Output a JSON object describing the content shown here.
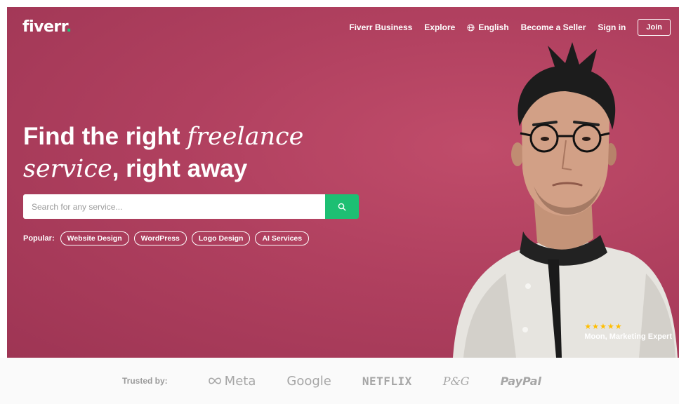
{
  "header": {
    "logo_text": "fiverr",
    "logo_dot": ".",
    "nav": {
      "business": "Fiverr Business",
      "explore": "Explore",
      "language": "English",
      "become_seller": "Become a Seller",
      "sign_in": "Sign in",
      "join": "Join"
    }
  },
  "hero": {
    "headline_part1": "Find the right ",
    "headline_italic1": "freelance",
    "headline_italic2": "service",
    "headline_part2": ", right away",
    "search": {
      "placeholder": "Search for any service...",
      "value": ""
    },
    "popular_label": "Popular:",
    "popular_tags": [
      "Website Design",
      "WordPress",
      "Logo Design",
      "AI Services"
    ],
    "testimonial": {
      "stars": "★★★★★",
      "name": "Moon, ",
      "role": "Marketing Expert"
    }
  },
  "trusted": {
    "label": "Trusted by:",
    "brands": [
      "Meta",
      "Google",
      "NETFLIX",
      "P&G",
      "PayPal"
    ]
  },
  "colors": {
    "hero_bg": "#b0405f",
    "accent_green": "#1dbf73",
    "star_yellow": "#ffbe00"
  },
  "icons": {
    "search": "search-icon",
    "globe": "globe-icon",
    "meta_logo": "meta-infinity-icon"
  }
}
